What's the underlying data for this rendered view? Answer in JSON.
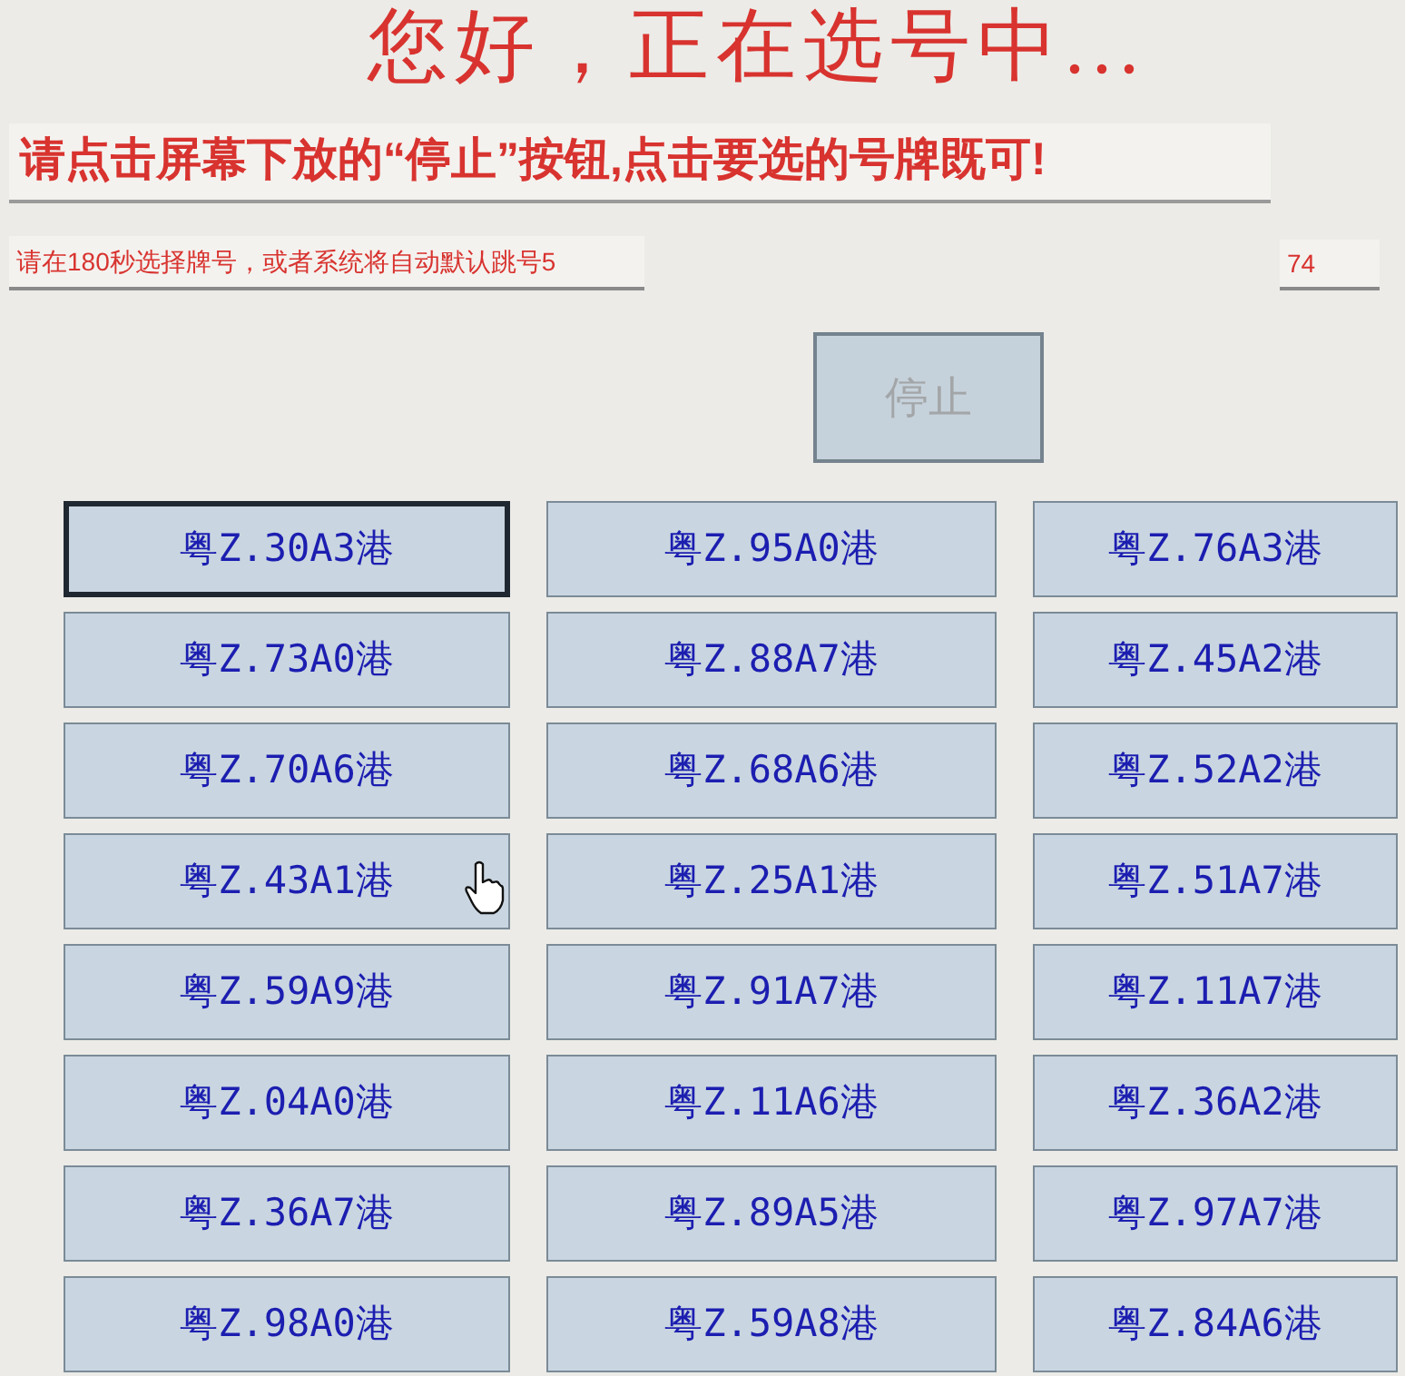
{
  "heading": "您好，正在选号中...",
  "instruction": "请点击屏幕下放的“停止”按钮,点击要选的号牌既可!",
  "notice_field": {
    "value": "请在180秒选择牌号，或者系统将自动默认跳号5"
  },
  "countdown_field": {
    "value": "74"
  },
  "stop_button": {
    "label": "停止",
    "disabled": true
  },
  "plates": [
    {
      "label": "粤Z.30A3港",
      "selected": true
    },
    {
      "label": "粤Z.95A0港",
      "selected": false
    },
    {
      "label": "粤Z.76A3港",
      "selected": false
    },
    {
      "label": "粤Z.73A0港",
      "selected": false
    },
    {
      "label": "粤Z.88A7港",
      "selected": false
    },
    {
      "label": "粤Z.45A2港",
      "selected": false
    },
    {
      "label": "粤Z.70A6港",
      "selected": false
    },
    {
      "label": "粤Z.68A6港",
      "selected": false
    },
    {
      "label": "粤Z.52A2港",
      "selected": false
    },
    {
      "label": "粤Z.43A1港",
      "selected": false
    },
    {
      "label": "粤Z.25A1港",
      "selected": false
    },
    {
      "label": "粤Z.51A7港",
      "selected": false
    },
    {
      "label": "粤Z.59A9港",
      "selected": false
    },
    {
      "label": "粤Z.91A7港",
      "selected": false
    },
    {
      "label": "粤Z.11A7港",
      "selected": false
    },
    {
      "label": "粤Z.04A0港",
      "selected": false
    },
    {
      "label": "粤Z.11A6港",
      "selected": false
    },
    {
      "label": "粤Z.36A2港",
      "selected": false
    },
    {
      "label": "粤Z.36A7港",
      "selected": false
    },
    {
      "label": "粤Z.89A5港",
      "selected": false
    },
    {
      "label": "粤Z.97A7港",
      "selected": false
    },
    {
      "label": "粤Z.98A0港",
      "selected": false
    },
    {
      "label": "粤Z.59A8港",
      "selected": false
    },
    {
      "label": "粤Z.84A6港",
      "selected": false
    }
  ]
}
